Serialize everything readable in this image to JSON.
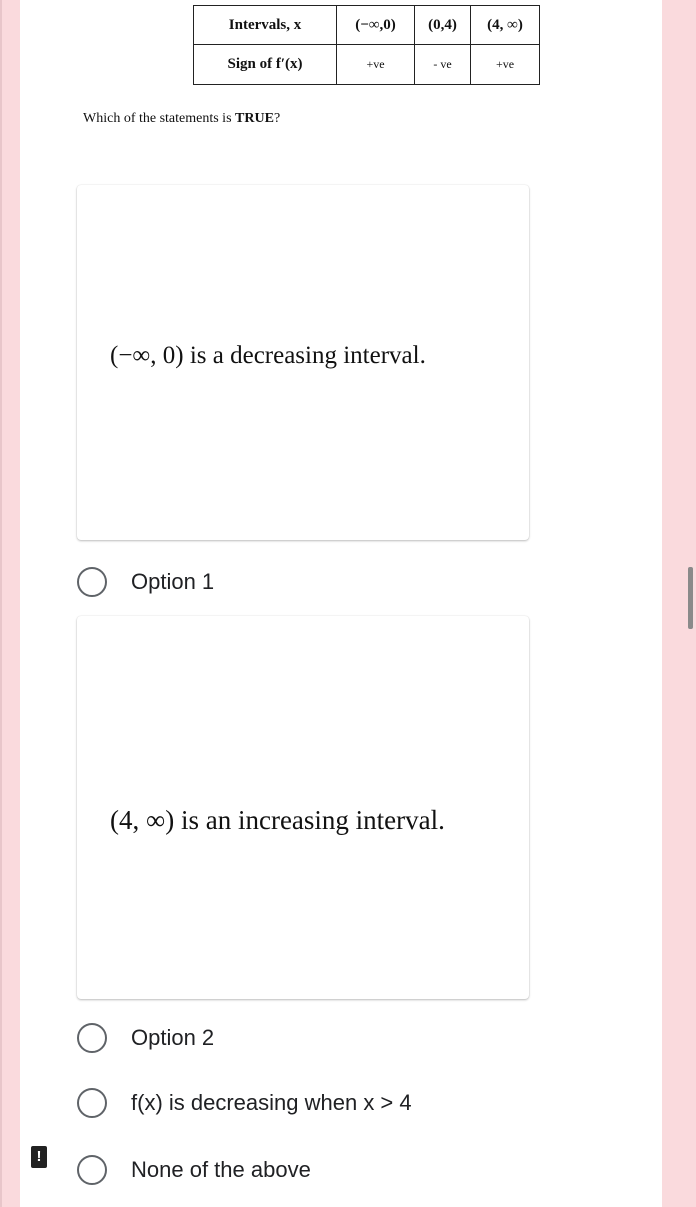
{
  "table": {
    "header": [
      "Intervals, x",
      "(−∞,0)",
      "(0,4)",
      "(4, ∞)"
    ],
    "row": [
      "Sign of f′(x)",
      "+ve",
      "- ve",
      "+ve"
    ]
  },
  "question": {
    "prefix": "Which of the statements is ",
    "emphasis": "TRUE",
    "suffix": "?"
  },
  "options": [
    {
      "image_text": "(−∞, 0) is a decreasing interval.",
      "label": "Option 1"
    },
    {
      "image_text": "(4, ∞) is an increasing interval.",
      "label": "Option 2"
    },
    {
      "label": "f(x) is decreasing when x > 4"
    },
    {
      "label": "None of the above"
    }
  ],
  "icons": {
    "alert": "!"
  }
}
